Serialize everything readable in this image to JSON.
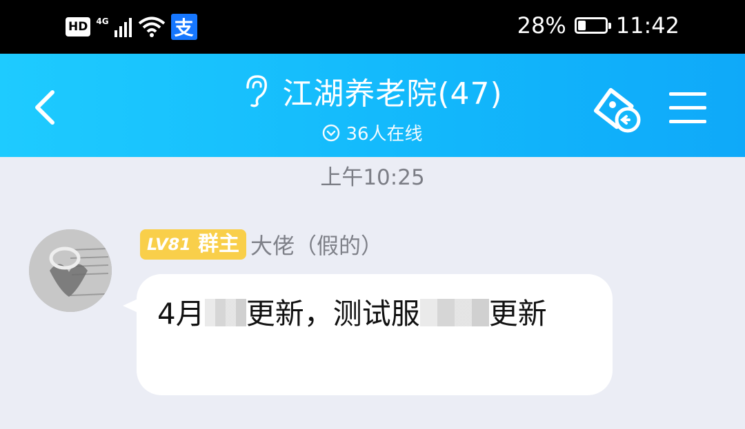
{
  "status_bar": {
    "hd": "HD",
    "network": "4G",
    "alipay_glyph": "支",
    "battery": "28%",
    "battery_level": 0.28,
    "time": "11:42"
  },
  "header": {
    "title": "江湖养老院(47)",
    "online": "36人在线",
    "icons": [
      "back-icon",
      "ear-icon",
      "chevron-circle-icon",
      "tag-icon",
      "menu-icon"
    ],
    "colors": {
      "gradient_start": "#1ecbff",
      "gradient_end": "#0fa9f9"
    }
  },
  "chat": {
    "timestamp": "上午10:25",
    "messages": [
      {
        "sender": {
          "level": "LV81",
          "role": "群主",
          "name": "大佬（假的）"
        },
        "text_parts": [
          "4月",
          "更新，测试服",
          "更新"
        ]
      }
    ]
  }
}
